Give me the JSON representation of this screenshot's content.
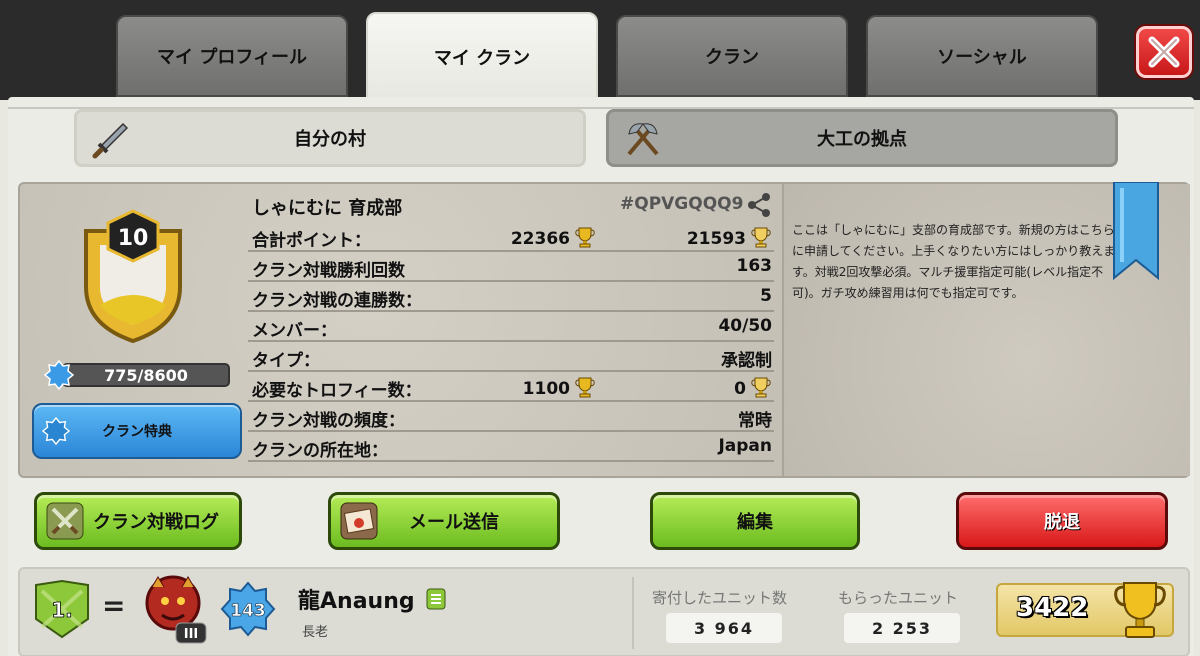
{
  "tabs": [
    "マイ プロフィール",
    "マイ クラン",
    "クラン",
    "ソーシャル"
  ],
  "active_tab": "マイ クラン",
  "close_label": "X",
  "village_tabs": {
    "home": "自分の村",
    "builder": "大工の拠点"
  },
  "clan": {
    "name": "しゃにむに 育成部",
    "tag": "#QPVGQQQ9",
    "level": "10",
    "xp": "775/8600",
    "perks_label": "クラン特典",
    "stats": [
      {
        "label": "合計ポイント：",
        "value1": "22366",
        "value2": "21593"
      },
      {
        "label": "クラン対戦勝利回数",
        "value": "163"
      },
      {
        "label": "クラン対戦の連勝数：",
        "value": "5"
      },
      {
        "label": "メンバー：",
        "value": "40/50"
      },
      {
        "label": "タイプ：",
        "value": "承認制"
      },
      {
        "label": "必要なトロフィー数：",
        "value1": "1100",
        "value2": "0"
      },
      {
        "label": "クラン対戦の頻度：",
        "value": "常時"
      },
      {
        "label": "クランの所在地：",
        "value": "Japan"
      }
    ],
    "description": "ここは「しゃにむに」支部の育成部です。新規の方はこちらに申請してください。上手くなりたい方にはしっかり教えます。対戦2回攻撃必須。マルチ援軍指定可能(レベル指定不可)。ガチ攻め練習用は何でも指定可です。"
  },
  "actions": {
    "war_log": "クラン対戦ログ",
    "mail": "メール送信",
    "edit": "編集",
    "leave": "脱退"
  },
  "member": {
    "rank": "1.",
    "rank_change": "=",
    "league_rank": "III",
    "xp_level": "143",
    "name": "龍Anaung",
    "role": "長老",
    "donated_label": "寄付したユニット数",
    "donated": "3 964",
    "received_label": "もらったユニット",
    "received": "2 253",
    "trophies": "3422"
  },
  "colors": {
    "green": "#8fd43a",
    "red": "#e53030",
    "blue": "#3a9ae6",
    "gold": "#e8c24a"
  }
}
